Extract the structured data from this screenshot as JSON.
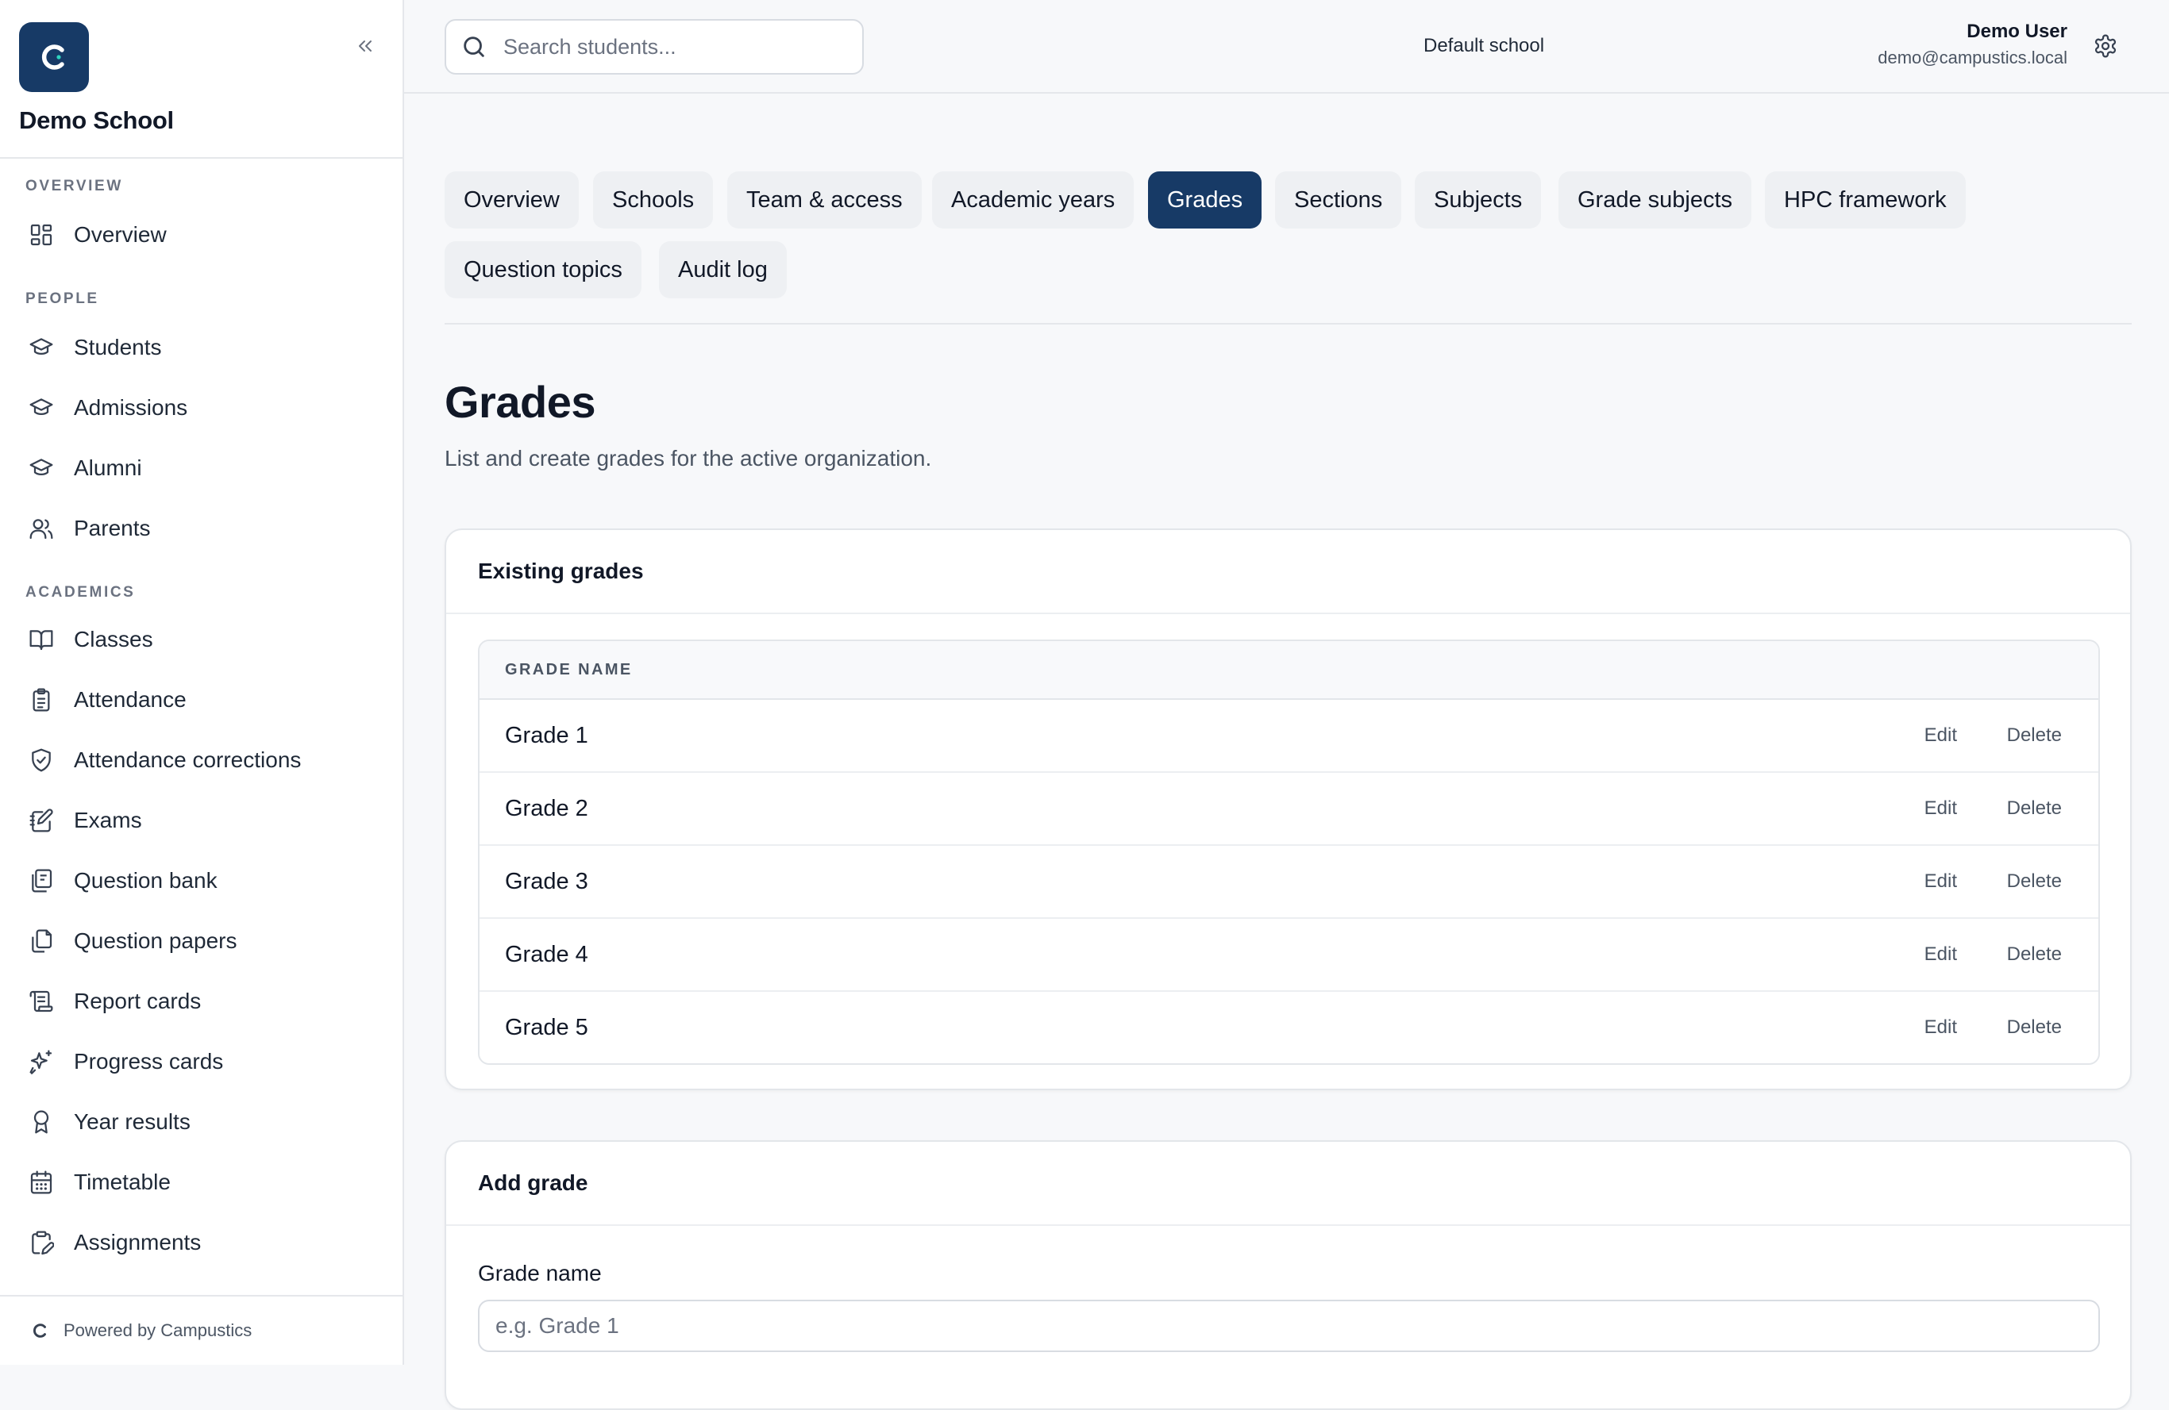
{
  "brand": {
    "logo_letter": "C",
    "name": "Demo School",
    "color": "#173a66"
  },
  "sidebar": {
    "sections": [
      {
        "title": "OVERVIEW",
        "items": [
          {
            "label": "Overview",
            "icon": "dashboard-grid-icon"
          }
        ]
      },
      {
        "title": "PEOPLE",
        "items": [
          {
            "label": "Students",
            "icon": "graduation-cap-icon"
          },
          {
            "label": "Admissions",
            "icon": "graduation-cap-icon"
          },
          {
            "label": "Alumni",
            "icon": "graduation-cap-icon"
          },
          {
            "label": "Parents",
            "icon": "users-icon"
          }
        ]
      },
      {
        "title": "ACADEMICS",
        "items": [
          {
            "label": "Classes",
            "icon": "open-book-icon"
          },
          {
            "label": "Attendance",
            "icon": "clipboard-list-icon"
          },
          {
            "label": "Attendance corrections",
            "icon": "shield-check-icon"
          },
          {
            "label": "Exams",
            "icon": "notebook-pen-icon"
          },
          {
            "label": "Question bank",
            "icon": "library-icon"
          },
          {
            "label": "Question papers",
            "icon": "copy-documents-icon"
          },
          {
            "label": "Report cards",
            "icon": "scroll-text-icon"
          },
          {
            "label": "Progress cards",
            "icon": "sparkles-icon"
          },
          {
            "label": "Year results",
            "icon": "award-icon"
          },
          {
            "label": "Timetable",
            "icon": "calendar-icon"
          },
          {
            "label": "Assignments",
            "icon": "clipboard-pen-icon"
          }
        ]
      }
    ],
    "footer": "Powered by Campustics"
  },
  "topbar": {
    "search_placeholder": "Search students...",
    "school": "Default school",
    "user_name": "Demo User",
    "user_email": "demo@campustics.local"
  },
  "tabs": [
    {
      "label": "Overview",
      "active": false
    },
    {
      "label": "Schools",
      "active": false
    },
    {
      "label": "Team & access",
      "active": false
    },
    {
      "label": "Academic years",
      "active": false
    },
    {
      "label": "Grades",
      "active": true
    },
    {
      "label": "Sections",
      "active": false
    },
    {
      "label": "Subjects",
      "active": false
    },
    {
      "label": "Grade subjects",
      "active": false
    },
    {
      "label": "HPC framework",
      "active": false
    },
    {
      "label": "Question topics",
      "active": false
    },
    {
      "label": "Audit log",
      "active": false
    }
  ],
  "page": {
    "title": "Grades",
    "description": "List and create grades for the active organization."
  },
  "existing": {
    "title": "Existing grades",
    "column_header": "GRADE NAME",
    "edit_label": "Edit",
    "delete_label": "Delete",
    "rows": [
      "Grade 1",
      "Grade 2",
      "Grade 3",
      "Grade 4",
      "Grade 5"
    ]
  },
  "add": {
    "title": "Add grade",
    "field_label": "Grade name",
    "field_placeholder": "e.g. Grade 1"
  }
}
